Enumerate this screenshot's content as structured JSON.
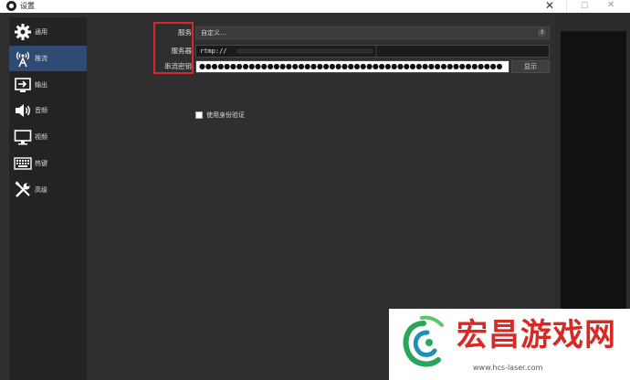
{
  "window": {
    "title": "设置"
  },
  "sidebar": {
    "items": [
      {
        "label": "通用",
        "icon": "gear-icon"
      },
      {
        "label": "推流",
        "icon": "broadcast-icon"
      },
      {
        "label": "输出",
        "icon": "output-icon"
      },
      {
        "label": "音频",
        "icon": "speaker-icon"
      },
      {
        "label": "视频",
        "icon": "monitor-icon"
      },
      {
        "label": "热键",
        "icon": "keyboard-icon"
      },
      {
        "label": "高级",
        "icon": "tools-icon"
      }
    ],
    "active_index": 1
  },
  "stream": {
    "service_label": "服务",
    "service_value": "自定义...",
    "server_label": "服务器",
    "server_value": "rtmp://",
    "key_label": "串流密钥",
    "key_value": "●●●●●●●●●●●●●●●●●●●●●●●●●●●●●●●●●●●●●●●●●●●●●●●●●",
    "show_button": "显示",
    "auth_label": "使用身份验证"
  },
  "watermark": {
    "brand": "宏昌游戏网",
    "url": "www.hcs-laser.com"
  },
  "colors": {
    "highlight": "#d9272e",
    "active_nav": "#2f4b73",
    "brand": "#d62a27"
  }
}
